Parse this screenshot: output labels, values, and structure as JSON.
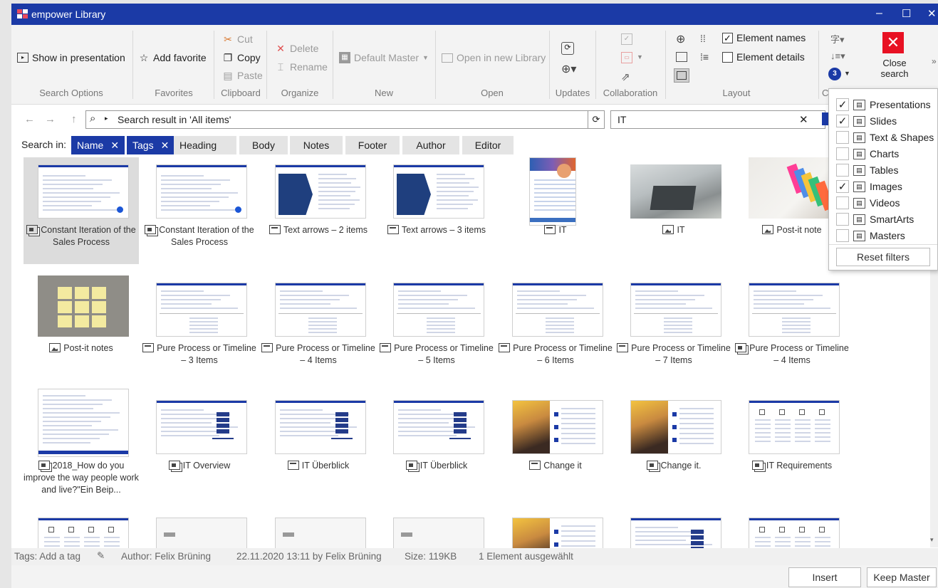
{
  "window": {
    "title": "empower Library",
    "controls": [
      "–",
      "☐",
      "✕"
    ]
  },
  "ribbon": {
    "search_options": {
      "show_in_presentation": "Show in presentation",
      "label": "Search Options"
    },
    "favorites": {
      "add_favorite": "Add favorite",
      "label": "Favorites"
    },
    "clipboard": {
      "cut": "Cut",
      "copy": "Copy",
      "paste": "Paste",
      "label": "Clipboard"
    },
    "organize": {
      "delete": "Delete",
      "rename": "Rename",
      "label": "Organize"
    },
    "new": {
      "default_master": "Default Master",
      "label": "New"
    },
    "open": {
      "open_in_new_library": "Open in new Library",
      "label": "Open"
    },
    "updates": {
      "label": "Updates"
    },
    "collaboration": {
      "label": "Collaboration"
    },
    "layout": {
      "element_names": "Element names",
      "element_details": "Element details",
      "label": "Layout",
      "element_names_checked": true,
      "element_details_checked": false
    },
    "custom": {
      "label": "Cu",
      "badge": "3"
    },
    "close_search": {
      "line1": "Close",
      "line2": "search"
    }
  },
  "address": {
    "path": "Search result in 'All items'",
    "search_value": "IT"
  },
  "search_in": {
    "label": "Search in:",
    "chips": [
      {
        "label": "Name",
        "selected": true
      },
      {
        "label": "Tags",
        "selected": true
      },
      {
        "label": "Heading",
        "selected": false
      },
      {
        "label": "Body",
        "selected": false
      },
      {
        "label": "Notes",
        "selected": false
      },
      {
        "label": "Footer",
        "selected": false
      },
      {
        "label": "Author",
        "selected": false
      },
      {
        "label": "Editor",
        "selected": false
      }
    ]
  },
  "items": [
    {
      "caption": "Constant Iteration of the Sales Process",
      "icon": "presentation",
      "thumb": "slide-text"
    },
    {
      "caption": "Constant Iteration of the Sales Process",
      "icon": "presentation",
      "thumb": "slide-text"
    },
    {
      "caption": "Text arrows – 2 items",
      "icon": "slide",
      "thumb": "arrows"
    },
    {
      "caption": "Text arrows – 3 items",
      "icon": "slide",
      "thumb": "arrows"
    },
    {
      "caption": "IT",
      "icon": "slide",
      "thumb": "portrait"
    },
    {
      "caption": "IT",
      "icon": "image",
      "thumb": "photo-desk"
    },
    {
      "caption": "Post-it note",
      "icon": "image",
      "thumb": "photo-postit"
    },
    {
      "caption": "Post-it notes",
      "icon": "image",
      "thumb": "photo-notes"
    },
    {
      "caption": "Pure Process or Timeline – 3 Items",
      "icon": "slide",
      "thumb": "timeline"
    },
    {
      "caption": "Pure Process or Timeline – 4 Items",
      "icon": "slide",
      "thumb": "timeline"
    },
    {
      "caption": "Pure Process or Timeline – 5 Items",
      "icon": "slide",
      "thumb": "timeline"
    },
    {
      "caption": "Pure Process or Timeline – 6 Items",
      "icon": "slide",
      "thumb": "timeline"
    },
    {
      "caption": "Pure Process or Timeline – 7 Items",
      "icon": "slide",
      "thumb": "timeline"
    },
    {
      "caption": "Pure Process or Timeline – 4 Items",
      "icon": "presentation",
      "thumb": "timeline"
    },
    {
      "caption": "2018_How do you improve the way people work and live?\"Ein Beip...",
      "icon": "presentation",
      "thumb": "portrait-doc"
    },
    {
      "caption": "IT Overview",
      "icon": "presentation",
      "thumb": "server"
    },
    {
      "caption": "IT Überblick",
      "icon": "slide",
      "thumb": "server"
    },
    {
      "caption": "IT Überblick",
      "icon": "presentation",
      "thumb": "server"
    },
    {
      "caption": "Change it",
      "icon": "slide",
      "thumb": "change"
    },
    {
      "caption": "Change it.",
      "icon": "presentation",
      "thumb": "change"
    },
    {
      "caption": "IT Requirements",
      "icon": "presentation",
      "thumb": "requirements"
    }
  ],
  "status": {
    "tags": "Tags: Add a tag",
    "author": "Author: Felix Brüning",
    "modified": "22.11.2020 13:11 by Felix Brüning",
    "size": "Size: 119KB",
    "selection": "1 Element ausgewählt"
  },
  "buttons": {
    "insert": "Insert",
    "keep_master": "Keep Master"
  },
  "filter_dropdown": {
    "items": [
      {
        "label": "Presentations",
        "checked": true
      },
      {
        "label": "Slides",
        "checked": true
      },
      {
        "label": "Text & Shapes",
        "checked": false
      },
      {
        "label": "Charts",
        "checked": false
      },
      {
        "label": "Tables",
        "checked": false
      },
      {
        "label": "Images",
        "checked": true
      },
      {
        "label": "Videos",
        "checked": false
      },
      {
        "label": "SmartArts",
        "checked": false
      },
      {
        "label": "Masters",
        "checked": false
      }
    ],
    "reset": "Reset filters"
  },
  "colors": {
    "accent": "#1b3aa6",
    "close_red": "#e81123"
  }
}
